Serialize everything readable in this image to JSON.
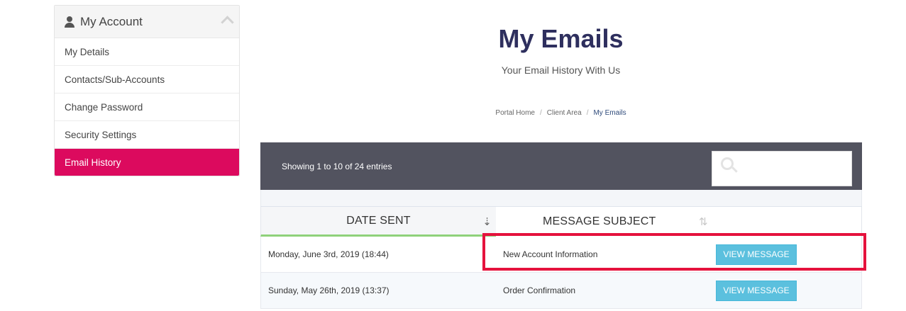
{
  "sidebar": {
    "title": "My Account",
    "items": [
      {
        "label": "My Details"
      },
      {
        "label": "Contacts/Sub-Accounts"
      },
      {
        "label": "Change Password"
      },
      {
        "label": "Security Settings"
      },
      {
        "label": "Email History",
        "active": true
      }
    ]
  },
  "header": {
    "title": "My Emails",
    "subtitle": "Your Email History With Us"
  },
  "breadcrumb": [
    "Portal Home",
    "Client Area",
    "My Emails"
  ],
  "table": {
    "info": "Showing 1 to 10 of 24 entries",
    "search": {
      "value": ""
    },
    "columns": [
      "DATE SENT",
      "MESSAGE SUBJECT"
    ],
    "rows": [
      {
        "date": "Monday, June 3rd, 2019 (18:44)",
        "subject": "New Account Information",
        "action": "VIEW MESSAGE"
      },
      {
        "date": "Sunday, May 26th, 2019 (13:37)",
        "subject": "Order Confirmation",
        "action": "VIEW MESSAGE"
      }
    ]
  },
  "colors": {
    "active_menu": "#dc0a5e",
    "title": "#2e2f5e",
    "toolbar": "#52535f",
    "button": "#5bc0de",
    "highlight": "#e5123d",
    "sort_underline": "#8fd17b"
  }
}
